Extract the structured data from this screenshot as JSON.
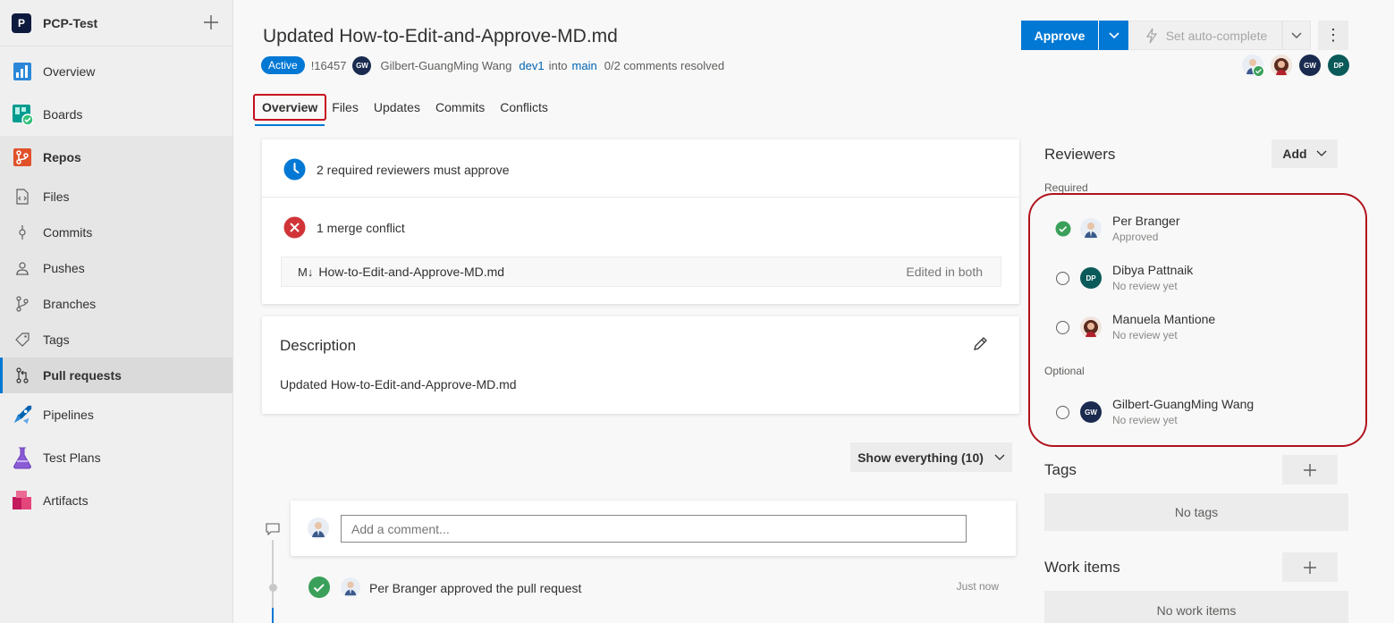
{
  "sidebar": {
    "project_initial": "P",
    "project_name": "PCP-Test",
    "items": {
      "overview": "Overview",
      "boards": "Boards",
      "repos": "Repos",
      "files": "Files",
      "commits": "Commits",
      "pushes": "Pushes",
      "branches": "Branches",
      "tags": "Tags",
      "pull_requests": "Pull requests",
      "pipelines": "Pipelines",
      "test_plans": "Test Plans",
      "artifacts": "Artifacts"
    }
  },
  "pr": {
    "title": "Updated How-to-Edit-and-Approve-MD.md",
    "status": "Active",
    "id": "!16457",
    "author_initials": "GW",
    "author": "Gilbert-GuangMing Wang",
    "source_branch": "dev1",
    "into": "into",
    "target_branch": "main",
    "comments_resolved": "0/2 comments resolved"
  },
  "actions": {
    "approve": "Approve",
    "auto_complete": "Set auto-complete",
    "more": "⋮"
  },
  "header_avatars": {
    "a3": "GW",
    "a4": "DP"
  },
  "tabs": {
    "overview": "Overview",
    "files": "Files",
    "updates": "Updates",
    "commits": "Commits",
    "conflicts": "Conflicts"
  },
  "status": {
    "reviewers_required": "2 required reviewers must approve",
    "merge_conflict": "1 merge conflict",
    "conflict_file_icon": "M↓",
    "conflict_file": "How-to-Edit-and-Approve-MD.md",
    "conflict_state": "Edited in both"
  },
  "description": {
    "title": "Description",
    "text": "Updated How-to-Edit-and-Approve-MD.md"
  },
  "activity": {
    "filter_label": "Show everything (10)",
    "comment_placeholder": "Add a comment...",
    "event_text": "Per Branger approved the pull request",
    "event_time": "Just now"
  },
  "reviewers": {
    "title": "Reviewers",
    "add_label": "Add",
    "required_label": "Required",
    "optional_label": "Optional",
    "required": [
      {
        "name": "Per Branger",
        "state": "Approved"
      },
      {
        "name": "Dibya Pattnaik",
        "initials": "DP",
        "state": "No review yet"
      },
      {
        "name": "Manuela Mantione",
        "state": "No review yet"
      }
    ],
    "optional": [
      {
        "name": "Gilbert-GuangMing Wang",
        "initials": "GW",
        "state": "No review yet"
      }
    ]
  },
  "tags": {
    "title": "Tags",
    "empty": "No tags"
  },
  "work_items": {
    "title": "Work items",
    "empty": "No work items"
  },
  "colors": {
    "accent": "#0078d4",
    "success": "#3aa05a",
    "error": "#d13438",
    "highlight": "#b0141c"
  }
}
